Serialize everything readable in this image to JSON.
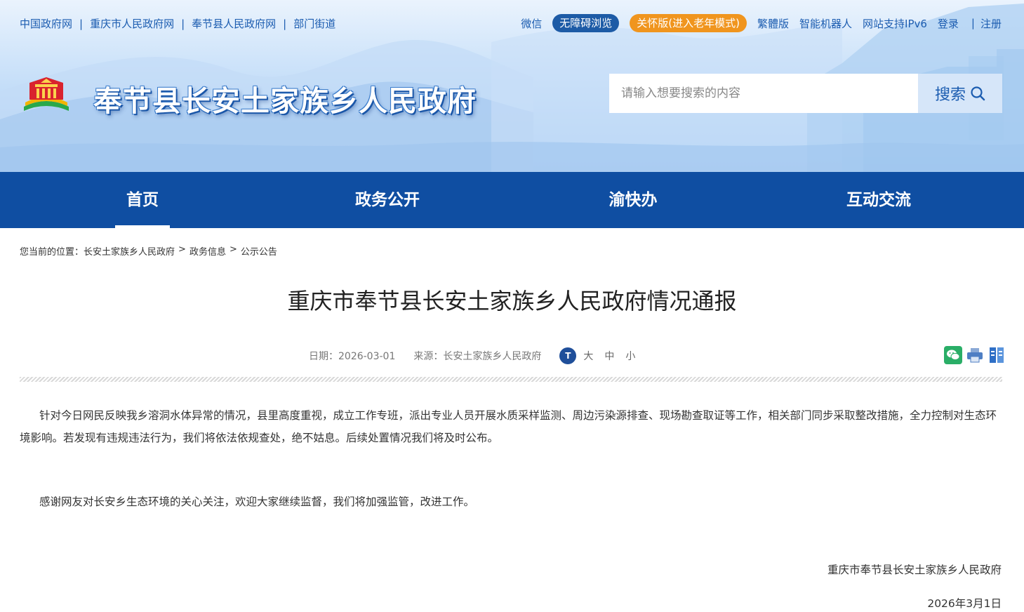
{
  "topbar": {
    "left_links": [
      "中国政府网",
      "重庆市人民政府网",
      "奉节县人民政府网",
      "部门街道"
    ],
    "separator": "|",
    "wechat": "微信",
    "accessible": "无障碍浏览",
    "elder_mode": "关怀版(进入老年模式)",
    "traditional": "繁體版",
    "robot": "智能机器人",
    "ipv6": "网站支持IPv6",
    "login": "登录",
    "register": "注册"
  },
  "header": {
    "site_title": "奉节县长安土家族乡人民政府",
    "search_placeholder": "请输入想要搜索的内容",
    "search_button": "搜索"
  },
  "nav": {
    "tabs": [
      "首页",
      "政务公开",
      "渝快办",
      "互动交流"
    ],
    "active_index": 0
  },
  "breadcrumb": {
    "prefix": "您当前的位置：",
    "items": [
      "长安土家族乡人民政府",
      "政务信息",
      "公示公告"
    ],
    "separator": ">"
  },
  "article": {
    "title": "重庆市奉节县长安土家族乡人民政府情况通报",
    "date": "日期：2026-03-01",
    "source": "来源：长安土家族乡人民政府",
    "font_size": {
      "icon": "T",
      "large": "大",
      "medium": "中",
      "small": "小"
    },
    "paragraphs": [
      "针对今日网民反映我乡溶洞水体异常的情况，县里高度重视，成立工作专班，派出专业人员开展水质采样监测、周边污染源排查、现场勘查取证等工作，相关部门同步采取整改措施，全力控制对生态环境影响。若发现有违规违法行为，我们将依法依规查处，绝不姑息。后续处置情况我们将及时公布。",
      "感谢网友对长安乡生态环境的关心关注，欢迎大家继续监督，我们将加强监管，改进工作。"
    ],
    "signature": "重庆市奉节县长安土家族乡人民政府",
    "sign_date": "2026年3月1日"
  },
  "colors": {
    "nav_blue": "#0f4ea2",
    "link_blue": "#1b5cb0",
    "pill_blue": "#1d5ba6",
    "pill_orange": "#f0951e",
    "wechat_green": "#2aae67"
  },
  "icons": [
    "emblem-logo",
    "search-icon",
    "font-size-icon",
    "wechat-share-icon",
    "print-icon",
    "collect-icon"
  ]
}
